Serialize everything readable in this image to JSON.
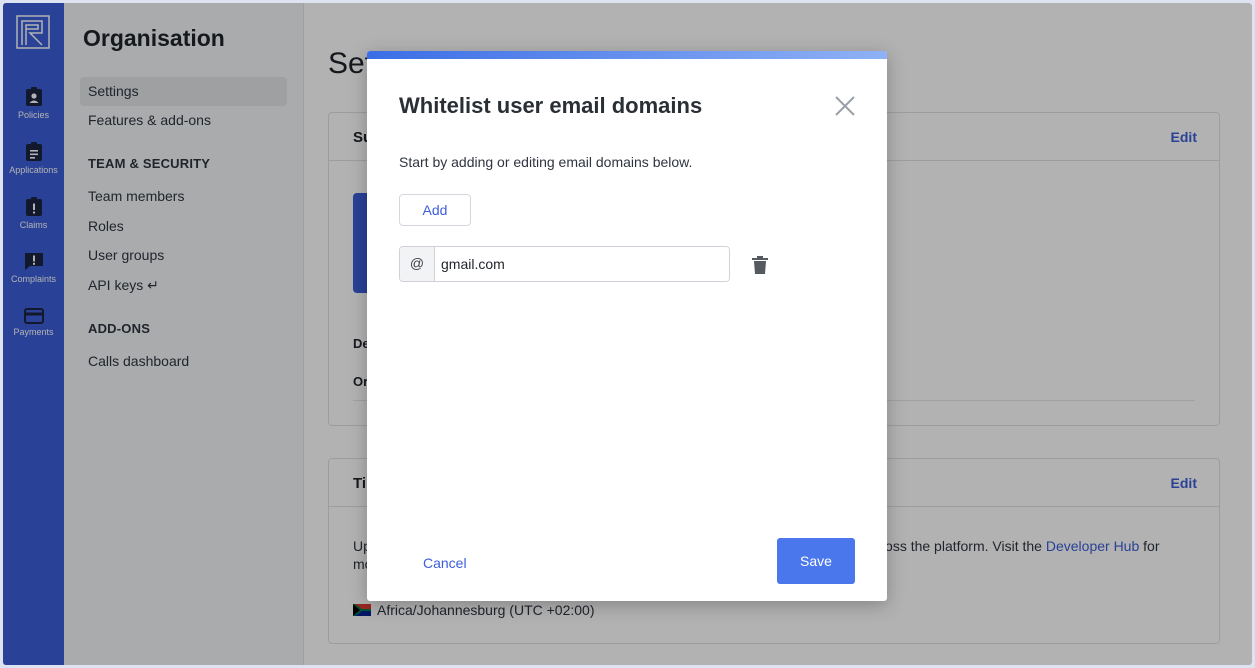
{
  "rail": {
    "items": [
      {
        "label": "Policies",
        "icon": "badge-icon"
      },
      {
        "label": "Applications",
        "icon": "clipboard-icon"
      },
      {
        "label": "Claims",
        "icon": "clipboard-alert-icon"
      },
      {
        "label": "Complaints",
        "icon": "chat-alert-icon"
      },
      {
        "label": "Payments",
        "icon": "credit-card-icon"
      }
    ],
    "color": "#3b5ed9"
  },
  "subnav": {
    "title": "Organisation",
    "items": [
      {
        "label": "Settings",
        "active": true
      },
      {
        "label": "Features & add-ons",
        "active": false
      }
    ],
    "team_heading": "TEAM & SECURITY",
    "team_items": [
      "Team members",
      "Roles",
      "User groups",
      "API keys ↵"
    ],
    "addons_heading": "ADD-ONS",
    "addons_items": [
      "Calls dashboard"
    ]
  },
  "main": {
    "page_title": "Set",
    "card1": {
      "title": "Su",
      "edit": "Edit",
      "row1": "De",
      "row2": "Or"
    },
    "card2": {
      "title": "Ti",
      "edit": "Edit",
      "text_left": "Up",
      "text_right": "d across the platform. Visit the",
      "link": "Developer Hub",
      "text_after": "for",
      "text_line2": "mo",
      "timezone": "Africa/Johannesburg (UTC +02:00)"
    }
  },
  "modal": {
    "title": "Whitelist user email domains",
    "description": "Start by adding or editing email domains below.",
    "add_label": "Add",
    "domain_prefix": "@",
    "domains": [
      "gmail.com"
    ],
    "cancel_label": "Cancel",
    "save_label": "Save",
    "accent": "#4a77ec"
  }
}
